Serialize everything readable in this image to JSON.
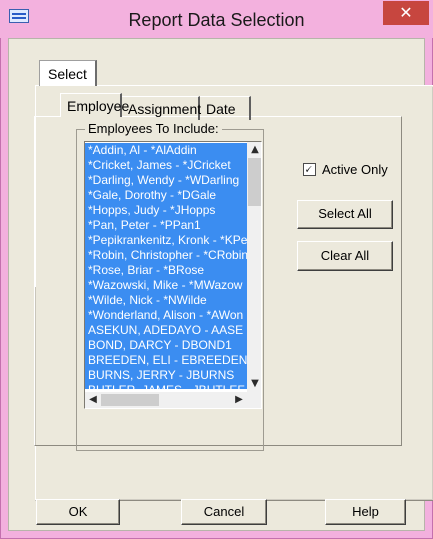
{
  "window": {
    "title": "Report Data Selection",
    "close_symbol": "✕"
  },
  "tabs": {
    "outer": [
      "Select"
    ],
    "inner": [
      "Employee",
      "Assignment",
      "Date"
    ]
  },
  "employees": {
    "group_label": "Employees To Include:",
    "items": [
      "*Addin, Al - *AlAddin",
      "*Cricket, James - *JCricket",
      "*Darling, Wendy - *WDarling",
      "*Gale, Dorothy - *DGale",
      "*Hopps, Judy - *JHopps",
      "*Pan, Peter - *PPan1",
      "*Pepikrankenitz, Kronk - *KPe",
      "*Robin, Christopher - *CRobin",
      "*Rose, Briar - *BRose",
      "*Wazowski, Mike - *MWazow",
      "*Wilde, Nick - *NWilde",
      "*Wonderland, Alison - *AWon",
      "ASEKUN, ADEDAYO - AASE",
      "BOND, DARCY - DBOND1",
      "BREEDEN, ELI - EBREEDEN",
      "BURNS, JERRY - JBURNS",
      "BUTLER, JAMES - JBUTLEF"
    ],
    "selected_color": "#3b8df1"
  },
  "options": {
    "active_only_label": "Active Only",
    "active_only_checked": true,
    "check_mark": "🗸"
  },
  "buttons": {
    "select_all": "Select All",
    "clear_all": "Clear All",
    "ok": "OK",
    "cancel": "Cancel",
    "help": "Help"
  },
  "scroll": {
    "up": "▲",
    "down": "▼",
    "left": "◀",
    "right": "▶"
  },
  "colors": {
    "title_bar": "#f3b1de",
    "close_button": "#c7463f",
    "dialog_face": "#ece9dc"
  }
}
